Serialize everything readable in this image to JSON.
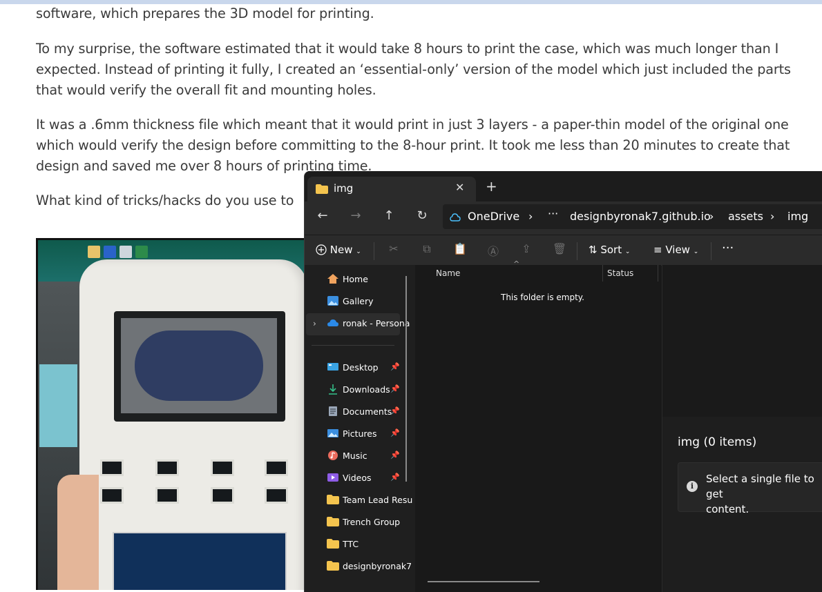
{
  "article": {
    "p1": "software, which prepares the 3D model for printing.",
    "p2": "To my surprise, the software estimated that it would take 8 hours to print the case, which was much longer than I expected. Instead of printing it fully, I created an ‘essential-only’ version of the model which just included the parts that would verify the overall fit and mounting holes.",
    "p3": "It was a .6mm thickness file which meant that it would print in just 3 layers - a paper-thin model of the original one which would verify the design before committing to the 8-hour print. It took me less than 20 minutes to create that design and saved me over 8 hours of printing time.",
    "p4": "What kind of tricks/hacks do you use to"
  },
  "explorer": {
    "tab_title": "img",
    "tab_close": "✕",
    "new_tab": "+",
    "nav": {
      "back": "←",
      "forward": "→",
      "up": "↑",
      "refresh": "↻"
    },
    "address": {
      "root": "OneDrive",
      "ellipsis": "···",
      "crumbs": [
        "designbyronak7.github.io",
        "assets",
        "img"
      ],
      "separator": "›"
    },
    "toolbar": {
      "new_label": "New",
      "sort_label": "Sort",
      "view_label": "View",
      "more_label": "···"
    },
    "sidebar": {
      "items": [
        {
          "label": "Home",
          "icon": "home-icon"
        },
        {
          "label": "Gallery",
          "icon": "gallery-icon"
        },
        {
          "label": "ronak - Persona",
          "icon": "cloud-icon"
        },
        {
          "label": "Desktop",
          "icon": "desktop-icon",
          "pinned": true
        },
        {
          "label": "Downloads",
          "icon": "download-icon",
          "pinned": true
        },
        {
          "label": "Documents",
          "icon": "document-icon",
          "pinned": true
        },
        {
          "label": "Pictures",
          "icon": "pictures-icon",
          "pinned": true
        },
        {
          "label": "Music",
          "icon": "music-icon",
          "pinned": true
        },
        {
          "label": "Videos",
          "icon": "videos-icon",
          "pinned": true
        },
        {
          "label": "Team Lead Resu",
          "icon": "folder-icon"
        },
        {
          "label": "Trench Group",
          "icon": "folder-icon"
        },
        {
          "label": "TTC",
          "icon": "folder-icon"
        },
        {
          "label": "designbyronak7",
          "icon": "folder-icon"
        }
      ]
    },
    "columns": {
      "name": "Name",
      "status": "Status"
    },
    "empty_message": "This folder is empty.",
    "details": {
      "title": "img (0 items)",
      "message": "Select a single file to get\ncontent."
    }
  },
  "colors": {
    "accent": "#4cc2ff",
    "folder": "#f4c44e",
    "window_bg": "#191919"
  }
}
